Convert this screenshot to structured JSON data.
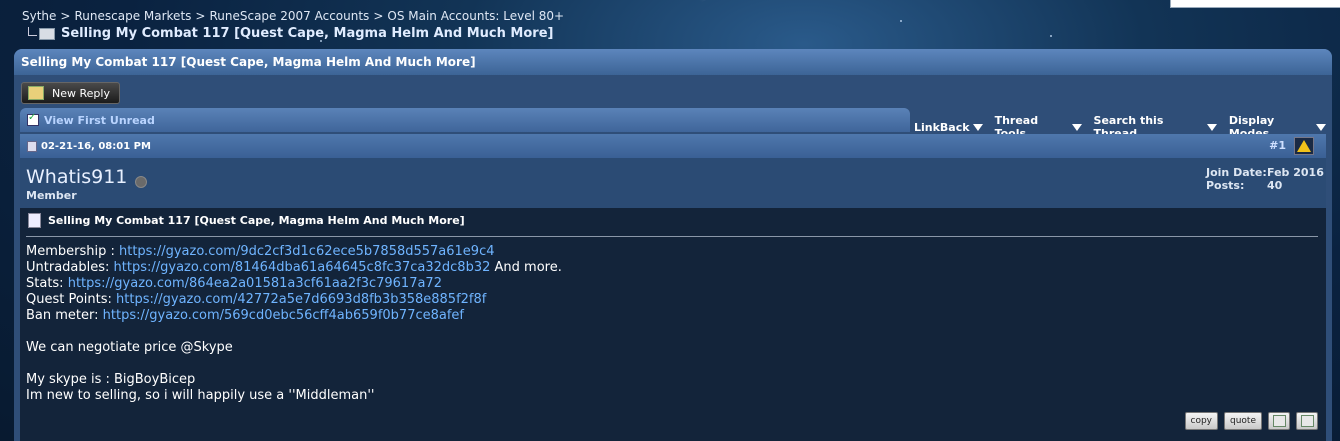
{
  "breadcrumb": {
    "items": [
      "Sythe",
      "Runescape Markets",
      "RuneScape 2007 Accounts",
      "OS Main Accounts: Level 80+"
    ],
    "separator": ">",
    "thread": "Selling My Combat 117 [Quest Cape, Magma Helm And Much More]"
  },
  "panel": {
    "title": "Selling My Combat 117 [Quest Cape, Magma Helm And Much More]"
  },
  "actions": {
    "new_reply": "New Reply"
  },
  "toolbar": {
    "view_first_unread": "View First Unread",
    "linkback": "LinkBack",
    "thread_tools": "Thread Tools",
    "search_thread": "Search this Thread",
    "display_modes": "Display Modes"
  },
  "post": {
    "date": "02-21-16, 08:01 PM",
    "number": "#1",
    "username": "Whatis911",
    "user_title": "Member",
    "join_label": "Join Date:",
    "join_value": "Feb 2016",
    "posts_label": "Posts:",
    "posts_value": "40",
    "title": "Selling My Combat 117 [Quest Cape, Magma Helm And Much More]",
    "lines": [
      {
        "label": "Membership : ",
        "link": "https://gyazo.com/9dc2cf3d1c62ece5b7858d557a61e9c4",
        "suffix": ""
      },
      {
        "label": "Untradables: ",
        "link": "https://gyazo.com/81464dba61a64645c8fc37ca32dc8b32",
        "suffix": " And more."
      },
      {
        "label": "Stats: ",
        "link": "https://gyazo.com/864ea2a01581a3cf61aa2f3c79617a72",
        "suffix": ""
      },
      {
        "label": "Quest Points: ",
        "link": "https://gyazo.com/42772a5e7d6693d8fb3b358e885f2f8f",
        "suffix": ""
      },
      {
        "label": "Ban meter: ",
        "link": "https://gyazo.com/569cd0ebc56cff4ab659f0b77ce8afef",
        "suffix": ""
      }
    ],
    "negotiate": "We can negotiate price @Skype",
    "skype": "My skype is : BigBoyBicep",
    "new_selling": "Im new to selling, so i will happily use a ''Middleman''",
    "copy_label": "copy",
    "quote_label": "quote"
  },
  "icons": {
    "warning": "warning-triangle-icon",
    "status": "offline-status-icon"
  }
}
